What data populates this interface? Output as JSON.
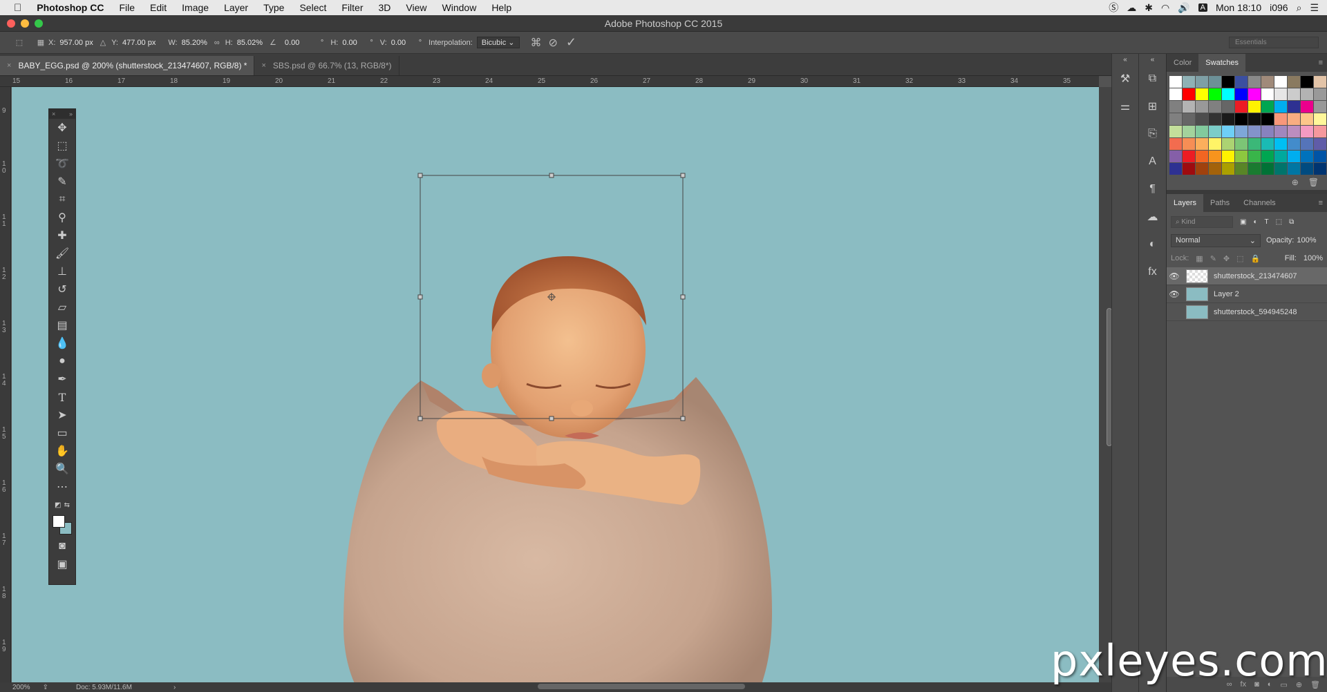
{
  "menubar": {
    "apple": "",
    "app_name": "Photoshop CC",
    "items": [
      "File",
      "Edit",
      "Image",
      "Layer",
      "Type",
      "Select",
      "Filter",
      "3D",
      "View",
      "Window",
      "Help"
    ],
    "clock": "Mon 18:10",
    "user": "i096"
  },
  "window": {
    "title": "Adobe Photoshop CC 2015"
  },
  "options": {
    "x_label": "X:",
    "x_value": "957.00 px",
    "y_label": "Y:",
    "y_value": "477.00 px",
    "w_label": "W:",
    "w_value": "85.20%",
    "h_label": "H:",
    "h_value": "85.02%",
    "angle_value": "0.00",
    "angle_unit": "°",
    "hskew_label": "H:",
    "hskew_value": "0.00",
    "hskew_unit": "°",
    "vskew_label": "V:",
    "vskew_value": "0.00",
    "vskew_unit": "°",
    "interp_label": "Interpolation:",
    "interp_value": "Bicubic",
    "workspace": "Essentials"
  },
  "tabs": [
    {
      "label": "BABY_EGG.psd @ 200% (shutterstock_213474607, RGB/8) *",
      "close": "×"
    },
    {
      "label": "SBS.psd @ 66.7% (13, RGB/8*)",
      "close": "×"
    }
  ],
  "ruler": {
    "h": [
      "15",
      "16",
      "17",
      "18",
      "19",
      "20",
      "21",
      "22",
      "23",
      "24",
      "25",
      "26",
      "27",
      "28",
      "29",
      "30",
      "31",
      "32",
      "33",
      "34",
      "35"
    ],
    "v": [
      "9",
      "1\n0",
      "1\n1",
      "1\n2",
      "1\n3",
      "1\n4",
      "1\n5",
      "1\n6",
      "1\n7",
      "1\n8",
      "1\n9"
    ]
  },
  "status": {
    "zoom": "200%",
    "doc": "Doc: 5.93M/11.6M",
    "arrow": "›"
  },
  "panels": {
    "color_tab": "Color",
    "swatches_tab": "Swatches",
    "layers_tab": "Layers",
    "paths_tab": "Paths",
    "channels_tab": "Channels",
    "kind_placeholder": "Kind",
    "blend_mode": "Normal",
    "opacity_label": "Opacity:",
    "opacity_value": "100%",
    "lock_label": "Lock:",
    "fill_label": "Fill:",
    "fill_value": "100%",
    "layers": [
      {
        "name": "shutterstock_213474607",
        "visible": true
      },
      {
        "name": "Layer 2",
        "visible": true
      },
      {
        "name": "shutterstock_594945248",
        "visible": false
      }
    ]
  },
  "swatches": [
    "#ffffff",
    "#8fb1b5",
    "#7e9fa5",
    "#6c9097",
    "#000000",
    "#3b4fa0",
    "#8a8a8a",
    "#a08a7a",
    "#ffffff",
    "#8a7a60",
    "#000000",
    "#e3c4a8",
    "#ffffff",
    "#ff0000",
    "#ffff00",
    "#00ff00",
    "#00ffff",
    "#0000ff",
    "#ff00ff",
    "#ffffff",
    "#e6e6e6",
    "#cccccc",
    "#b3b3b3",
    "#999999",
    "#808080",
    "#b3b3b3",
    "#999999",
    "#808080",
    "#666666",
    "#ed1c24",
    "#fff200",
    "#00a651",
    "#00aeef",
    "#2e3192",
    "#ec008c",
    "#999999",
    "#808080",
    "#666666",
    "#4d4d4d",
    "#333333",
    "#1a1a1a",
    "#000000",
    "#111111",
    "#000000",
    "#f7977a",
    "#f9ad81",
    "#fdc68a",
    "#fff79a",
    "#c4df9b",
    "#a3d39c",
    "#82ca9d",
    "#7bcdc8",
    "#6ecff6",
    "#7ea7d8",
    "#8493ca",
    "#8882be",
    "#a187be",
    "#bc8dbf",
    "#f49ac2",
    "#f6989d",
    "#f26c4f",
    "#f68e55",
    "#fbaf5c",
    "#fff467",
    "#acd372",
    "#7cc576",
    "#3bb878",
    "#1abbb4",
    "#00bff3",
    "#438ccb",
    "#5574b9",
    "#605ca8",
    "#855fa8",
    "#ed1c24",
    "#f26522",
    "#f7941d",
    "#fff200",
    "#8dc73f",
    "#39b54a",
    "#00a651",
    "#00a99d",
    "#00aeef",
    "#0072bc",
    "#0054a6",
    "#2e3192",
    "#9e0b0f",
    "#a0410d",
    "#a3620a",
    "#aba000",
    "#598527",
    "#1a7b30",
    "#007236",
    "#00746b",
    "#0076a3",
    "#004b80",
    "#003471",
    "#1b1464"
  ],
  "watermark": "pxleyes.com"
}
